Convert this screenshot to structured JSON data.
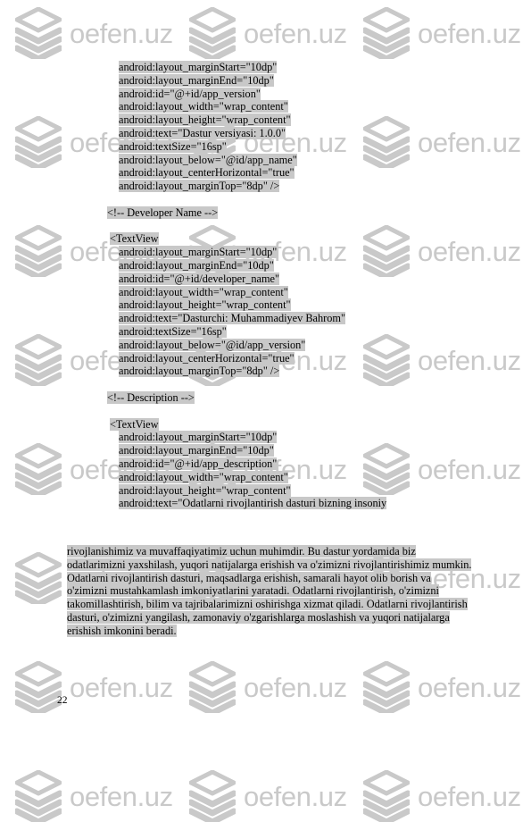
{
  "page": {
    "number": "22",
    "background_color": "#ffffff",
    "highlight_color": "#c8c8c8",
    "text_color": "#000000"
  },
  "watermark": {
    "text": "oefen.uz",
    "color": "#c9c9c9",
    "logo_icon": "stacked-layers-icon",
    "columns": 3,
    "rows": 8,
    "x_step": 195,
    "y_step": 122
  },
  "code": {
    "language": "xml-android-layout",
    "lines": [
      {
        "indent": "attr",
        "text": "android:layout_marginStart=\"10dp\""
      },
      {
        "indent": "attr",
        "text": "android:layout_marginEnd=\"10dp\""
      },
      {
        "indent": "attr",
        "text": "android:id=\"@+id/app_version\""
      },
      {
        "indent": "attr",
        "text": "android:layout_width=\"wrap_content\""
      },
      {
        "indent": "attr",
        "text": "android:layout_height=\"wrap_content\""
      },
      {
        "indent": "attr",
        "text": "android:text=\"Dastur versiyasi: 1.0.0\""
      },
      {
        "indent": "attr",
        "text": "android:textSize=\"16sp\""
      },
      {
        "indent": "attr",
        "text": "android:layout_below=\"@id/app_name\""
      },
      {
        "indent": "attr",
        "text": "android:layout_centerHorizontal=\"true\""
      },
      {
        "indent": "attr",
        "text": "android:layout_marginTop=\"8dp\" />"
      },
      {
        "indent": "blank",
        "text": ""
      },
      {
        "indent": "cmt",
        "text": "<!-- Developer Name -->"
      },
      {
        "indent": "blank",
        "text": ""
      },
      {
        "indent": "tag",
        "text": "<TextView"
      },
      {
        "indent": "attr",
        "text": "android:layout_marginStart=\"10dp\""
      },
      {
        "indent": "attr",
        "text": "android:layout_marginEnd=\"10dp\""
      },
      {
        "indent": "attr",
        "text": "android:id=\"@+id/developer_name\""
      },
      {
        "indent": "attr",
        "text": "android:layout_width=\"wrap_content\""
      },
      {
        "indent": "attr",
        "text": "android:layout_height=\"wrap_content\""
      },
      {
        "indent": "attr",
        "text": "android:text=\"Dasturchi: Muhammadiyev Bahrom\""
      },
      {
        "indent": "attr",
        "text": "android:textSize=\"16sp\""
      },
      {
        "indent": "attr",
        "text": "android:layout_below=\"@id/app_version\""
      },
      {
        "indent": "attr",
        "text": "android:layout_centerHorizontal=\"true\""
      },
      {
        "indent": "attr",
        "text": "android:layout_marginTop=\"8dp\" />"
      },
      {
        "indent": "blank",
        "text": ""
      },
      {
        "indent": "cmt",
        "text": "<!-- Description -->"
      },
      {
        "indent": "blank",
        "text": ""
      },
      {
        "indent": "tag",
        "text": "<TextView"
      },
      {
        "indent": "attr",
        "text": "android:layout_marginStart=\"10dp\""
      },
      {
        "indent": "attr",
        "text": "android:layout_marginEnd=\"10dp\""
      },
      {
        "indent": "attr",
        "text": "android:id=\"@+id/app_description\""
      },
      {
        "indent": "attr",
        "text": "android:layout_width=\"wrap_content\""
      },
      {
        "indent": "attr",
        "text": "android:layout_height=\"wrap_content\""
      },
      {
        "indent": "attr",
        "text": "android:text=\"Odatlarni rivojlantirish dasturi bizning insoniy"
      }
    ],
    "description_wrapped": "rivojlanishimiz va muvaffaqiyatimiz uchun muhimdir. Bu dastur yordamida biz odatlarimizni yaxshilash, yuqori natijalarga erishish va o'zimizni rivojlantirishimiz mumkin. Odatlarni rivojlantirish dasturi, maqsadlarga erishish, samarali hayot olib borish va o'zimizni mustahkamlash imkoniyatlarini yaratadi. Odatlarni rivojlantirish, o'zimizni takomillashtirish, bilim va tajribalarimizni oshirishga xizmat qiladi. Odatlarni rivojlantirish dasturi, o'zimizni yangilash, zamonaviy o'zgarishlarga moslashish va yuqori natijalarga erishish imkonini beradi."
  }
}
